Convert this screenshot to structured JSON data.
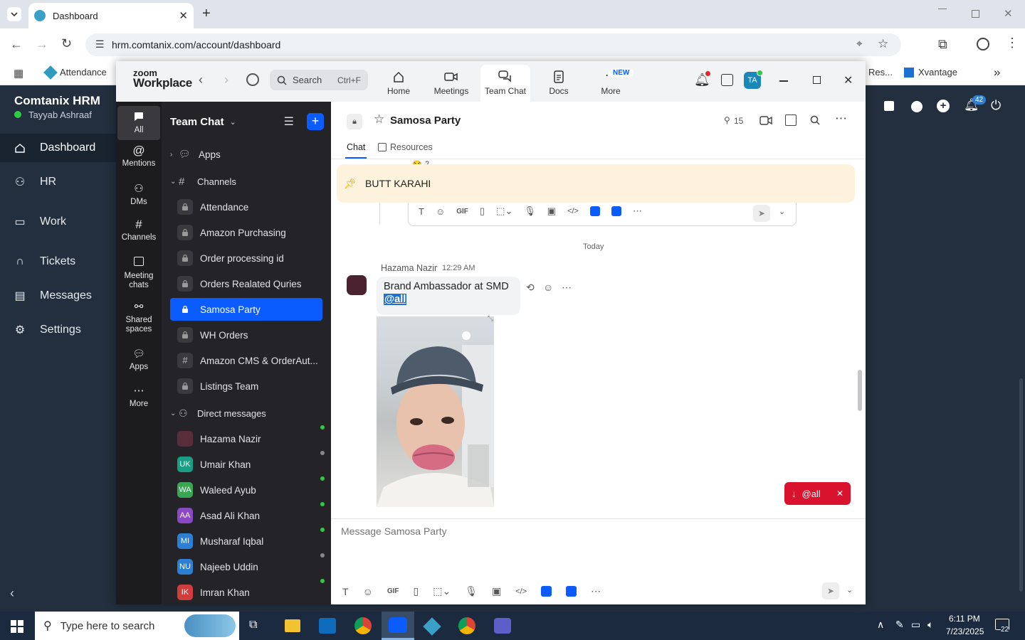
{
  "browser": {
    "tab_title": "Dashboard",
    "url": "hrm.comtanix.com/account/dashboard",
    "bookmarks": [
      {
        "label": "Attendance"
      },
      {
        "label": "Res..."
      },
      {
        "label": "Xvantage"
      }
    ]
  },
  "hrm": {
    "app_name": "Comtanix HRM",
    "user_name": "Tayyab Ashraaf",
    "notification_count": "42",
    "nav": [
      {
        "label": "Dashboard",
        "icon": "home-icon"
      },
      {
        "label": "HR",
        "icon": "users-icon"
      },
      {
        "label": "Work",
        "icon": "briefcase-icon"
      },
      {
        "label": "Tickets",
        "icon": "headset-icon"
      },
      {
        "label": "Messages",
        "icon": "message-icon"
      },
      {
        "label": "Settings",
        "icon": "gear-icon"
      }
    ]
  },
  "zoom": {
    "brand_top": "zoom",
    "brand_bottom": "Workplace",
    "search_label": "Search",
    "search_shortcut": "Ctrl+F",
    "tabs": [
      {
        "label": "Home",
        "icon": "home-icon"
      },
      {
        "label": "Meetings",
        "icon": "video-icon"
      },
      {
        "label": "Team Chat",
        "icon": "chat-icon"
      },
      {
        "label": "Docs",
        "icon": "docs-icon"
      },
      {
        "label": "More",
        "icon": "more-icon"
      }
    ],
    "new_badge": "NEW",
    "avatar_initials": "TA",
    "rail": [
      {
        "label": "All"
      },
      {
        "label": "Mentions"
      },
      {
        "label": "DMs"
      },
      {
        "label": "Channels"
      },
      {
        "label": "Meeting chats"
      },
      {
        "label": "Shared spaces"
      },
      {
        "label": "Apps"
      },
      {
        "label": "More"
      }
    ],
    "panel": {
      "title": "Team Chat",
      "apps_label": "Apps",
      "channels_label": "Channels",
      "channels": [
        {
          "label": "Attendance"
        },
        {
          "label": "Amazon Purchasing"
        },
        {
          "label": "Order processing id"
        },
        {
          "label": "Orders Realated Quries"
        },
        {
          "label": "Samosa Party"
        },
        {
          "label": "WH Orders"
        },
        {
          "label": "Amazon CMS & OrderAut..."
        },
        {
          "label": "Listings Team"
        }
      ],
      "dm_label": "Direct messages",
      "dms": [
        {
          "name": "Hazama Nazir",
          "initials": "",
          "color": "#5a2d3a",
          "status": "#2ecc40"
        },
        {
          "name": "Umair Khan",
          "initials": "UK",
          "color": "#1a9e83",
          "status": "#888"
        },
        {
          "name": "Waleed Ayub",
          "initials": "WA",
          "color": "#3aa654",
          "status": "#2ecc40"
        },
        {
          "name": "Asad Ali Khan",
          "initials": "AA",
          "color": "#8b48c5",
          "status": "#2ecc40"
        },
        {
          "name": "Musharaf Iqbal",
          "initials": "MI",
          "color": "#2d7fd3",
          "status": "#2ecc40"
        },
        {
          "name": "Najeeb Uddin",
          "initials": "NU",
          "color": "#2d7fd3",
          "status": "#888"
        },
        {
          "name": "Imran Khan",
          "initials": "IK",
          "color": "#d13c3c",
          "status": "#2ecc40"
        }
      ]
    },
    "chat": {
      "channel": "Samosa Party",
      "member_count": "15",
      "tab_chat": "Chat",
      "tab_resources": "Resources",
      "pinned": "BUTT KARAHI",
      "reaction_count": "2",
      "day_divider": "Today",
      "message": {
        "sender": "Hazama Nazir",
        "time": "12:29 AM",
        "text": "Brand Ambassador at SMD",
        "mention": "@all"
      },
      "jump_label": "@all",
      "composer_placeholder": "Message Samosa Party"
    }
  },
  "taskbar": {
    "search_placeholder": "Type here to search",
    "time": "6:11 PM",
    "date": "7/23/2025",
    "notifications": "22"
  }
}
